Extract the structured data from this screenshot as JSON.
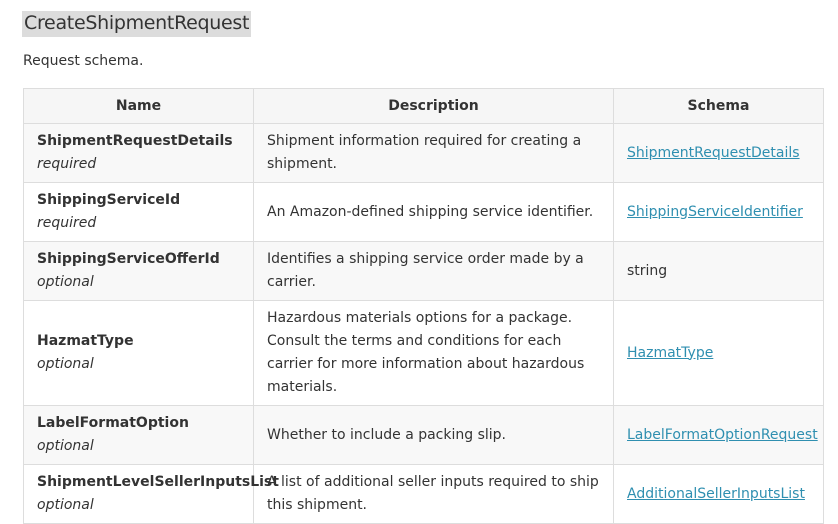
{
  "heading": "CreateShipmentRequest",
  "subtitle": "Request schema.",
  "table": {
    "headers": [
      "Name",
      "Description",
      "Schema"
    ],
    "rows": [
      {
        "name": "ShipmentRequestDetails",
        "requirement": "required",
        "description": "Shipment information required for creating a shipment.",
        "schema": "ShipmentRequestDetails",
        "schema_is_link": true
      },
      {
        "name": "ShippingServiceId",
        "requirement": "required",
        "description": "An Amazon-defined shipping service identifier.",
        "schema": "ShippingServiceIdentifier",
        "schema_is_link": true
      },
      {
        "name": "ShippingServiceOfferId",
        "requirement": "optional",
        "description": "Identifies a shipping service order made by a carrier.",
        "schema": "string",
        "schema_is_link": false
      },
      {
        "name": "HazmatType",
        "requirement": "optional",
        "description": "Hazardous materials options for a package. Consult the terms and conditions for each carrier for more information about hazardous materials.",
        "schema": "HazmatType",
        "schema_is_link": true
      },
      {
        "name": "LabelFormatOption",
        "requirement": "optional",
        "description": "Whether to include a packing slip.",
        "schema": "LabelFormatOptionRequest",
        "schema_is_link": true
      },
      {
        "name": "ShipmentLevelSellerInputsList",
        "requirement": "optional",
        "description": "A list of additional seller inputs required to ship this shipment.",
        "schema": "AdditionalSellerInputsList",
        "schema_is_link": true
      }
    ]
  },
  "colors": {
    "link": "#2f8fb0",
    "heading_highlight": "#dcdcdc",
    "border": "#dddddd"
  }
}
